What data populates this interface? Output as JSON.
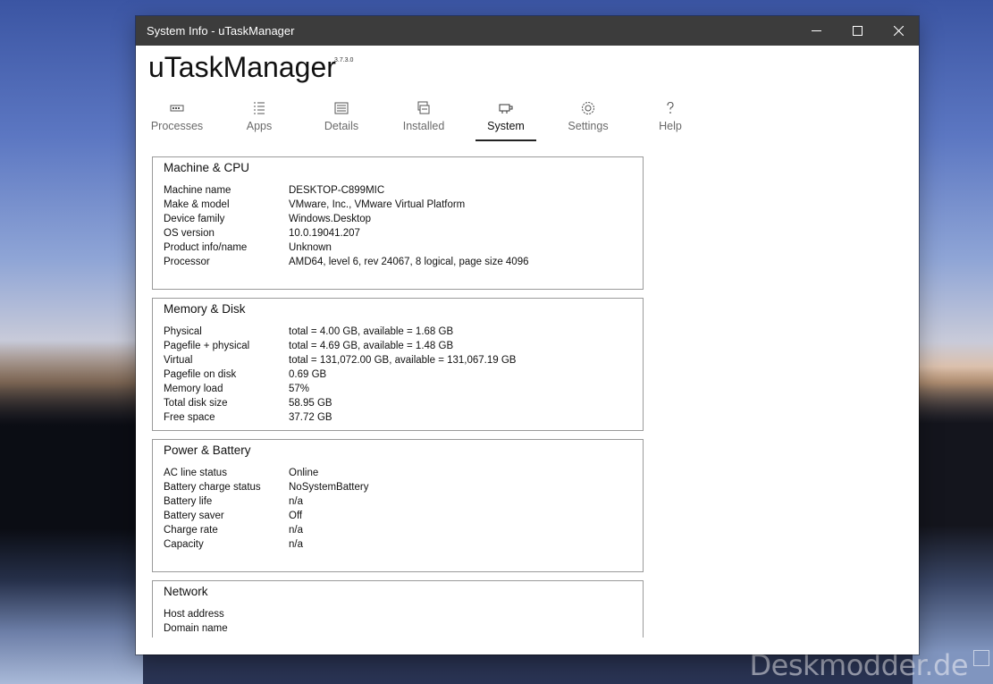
{
  "window": {
    "title": "System Info - uTaskManager"
  },
  "app": {
    "name": "uTaskManager",
    "version": "3.7.3.0"
  },
  "tabs": [
    {
      "label": "Processes",
      "icon": "processes-icon"
    },
    {
      "label": "Apps",
      "icon": "apps-list-icon"
    },
    {
      "label": "Details",
      "icon": "details-icon"
    },
    {
      "label": "Installed",
      "icon": "installed-icon"
    },
    {
      "label": "System",
      "icon": "system-icon",
      "active": true
    },
    {
      "label": "Settings",
      "icon": "gear-icon"
    },
    {
      "label": "Help",
      "icon": "help-icon"
    }
  ],
  "sections": {
    "machine": {
      "title": "Machine & CPU",
      "rows": [
        {
          "k": "Machine name",
          "v": "DESKTOP-C899MIC"
        },
        {
          "k": "Make & model",
          "v": "VMware, Inc., VMware Virtual Platform"
        },
        {
          "k": "Device family",
          "v": "Windows.Desktop"
        },
        {
          "k": "OS version",
          "v": "10.0.19041.207"
        },
        {
          "k": "Product info/name",
          "v": "Unknown"
        },
        {
          "k": "Processor",
          "v": "AMD64, level 6, rev 24067, 8 logical, page size 4096"
        }
      ]
    },
    "memory": {
      "title": "Memory & Disk",
      "rows": [
        {
          "k": "Physical",
          "v": "total = 4.00 GB, available = 1.68 GB"
        },
        {
          "k": "Pagefile + physical",
          "v": "total = 4.69 GB, available = 1.48 GB"
        },
        {
          "k": "Virtual",
          "v": "total = 131,072.00 GB, available = 131,067.19 GB"
        },
        {
          "k": "Pagefile on disk",
          "v": "0.69 GB"
        },
        {
          "k": "Memory load",
          "v": "57%"
        },
        {
          "k": "Total disk size",
          "v": "58.95 GB"
        },
        {
          "k": "Free space",
          "v": "37.72 GB"
        }
      ]
    },
    "power": {
      "title": "Power & Battery",
      "rows": [
        {
          "k": "AC line status",
          "v": "Online"
        },
        {
          "k": "Battery charge status",
          "v": "NoSystemBattery"
        },
        {
          "k": "Battery life",
          "v": "n/a"
        },
        {
          "k": "Battery saver",
          "v": "Off"
        },
        {
          "k": "Charge rate",
          "v": "n/a"
        },
        {
          "k": "Capacity",
          "v": "n/a"
        }
      ]
    },
    "network": {
      "title": "Network",
      "rows": [
        {
          "k": "Host address",
          "v": ""
        },
        {
          "k": "Domain name",
          "v": ""
        }
      ]
    }
  },
  "watermark": "Deskmodder.de"
}
